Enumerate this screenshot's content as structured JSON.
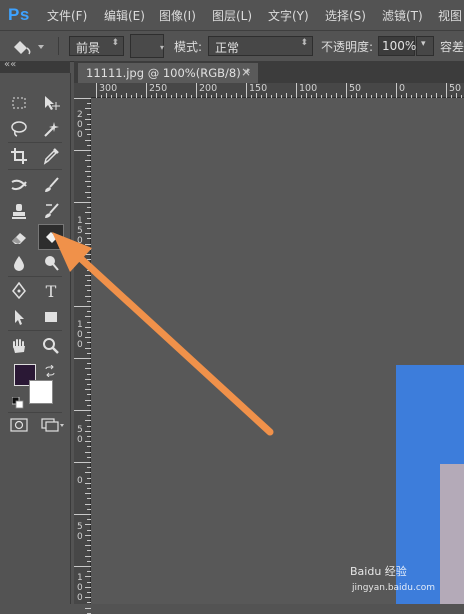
{
  "app": {
    "logo": "Ps"
  },
  "menubar": {
    "items": [
      "文件(F)",
      "编辑(E)",
      "图像(I)",
      "图层(L)",
      "文字(Y)",
      "选择(S)",
      "滤镜(T)",
      "视图"
    ]
  },
  "options": {
    "paint_target": "前景",
    "mode_label": "模式:",
    "mode_value": "正常",
    "opacity_label": "不透明度:",
    "opacity_value": "100%",
    "tolerance_label": "容差"
  },
  "document_tab": {
    "title": "11111.jpg @ 100%(RGB/8) *",
    "close": "×"
  },
  "toolbar": {
    "collapse": "««"
  },
  "ruler": {
    "top_labels": [
      "300",
      "250",
      "200",
      "150",
      "100",
      "50",
      "0",
      "50"
    ],
    "left_labels": [
      "2\n0\n0",
      "1\n5\n0",
      "1\n0\n0",
      "5\n0",
      "0",
      "5\n0",
      "1\n0\n0"
    ]
  },
  "colors": {
    "foreground": "#2a1835",
    "background": "#ffffff",
    "annotation_arrow": "#f0914a",
    "image_primary": "#3d7ddb"
  },
  "watermark": {
    "brand": "Baidu 经验",
    "url": "jingyan.baidu.com"
  }
}
